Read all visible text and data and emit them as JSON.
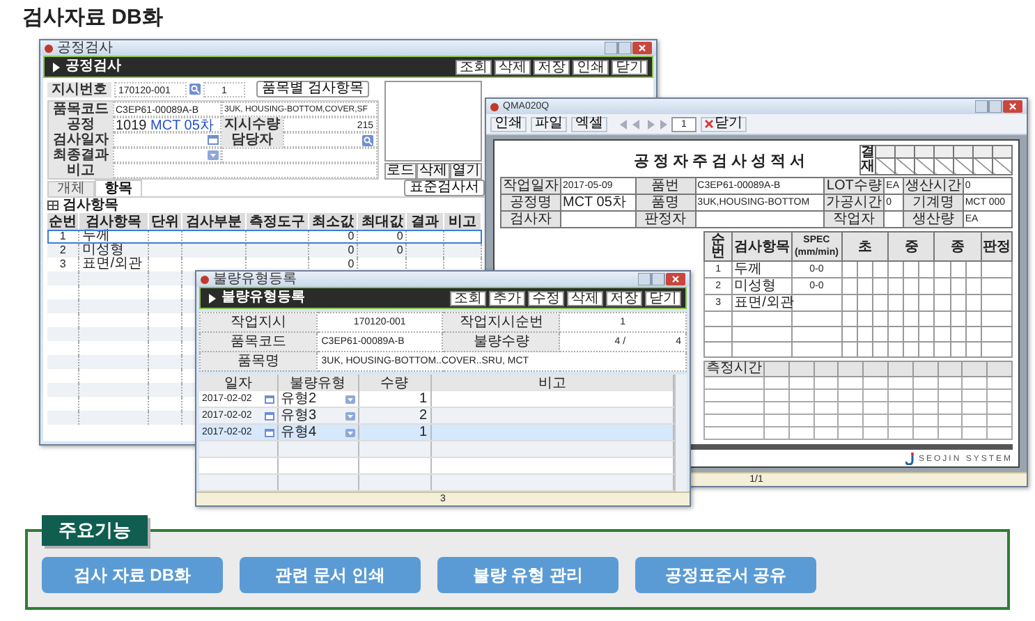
{
  "title": "검사자료 DB화",
  "inspection_window": {
    "title": "공정검사",
    "header": "공정검사",
    "toolbar": [
      "조회",
      "삭제",
      "저장",
      "인쇄",
      "닫기"
    ],
    "form": {
      "order_no_label": "지시번호",
      "order_no": "170120-001",
      "order_seq": "1",
      "item_button": "품목별 검사항목",
      "item_code_label": "품목코드",
      "item_code": "C3EP61-00089A-B",
      "item_name": "3UK, HOUSING-BOTTOM,COVER,SF",
      "process_label": "공정",
      "process_code": "1019",
      "process_name": "MCT 05차",
      "qty_label": "지시수량",
      "qty": "215",
      "date_label": "검사일자",
      "manager_label": "담당자",
      "result_label": "최종결과",
      "remark_label": "비고"
    },
    "attachment_buttons": [
      "로드",
      "삭제",
      "열기"
    ],
    "tabs": [
      {
        "label": "개체",
        "selected": false
      },
      {
        "label": "항목",
        "selected": true
      }
    ],
    "standard_button": "표준검사서",
    "section": "검사항목",
    "table": {
      "columns": [
        "순번",
        "검사항목",
        "단위",
        "검사부분",
        "측정도구",
        "최소값",
        "최대값",
        "결과",
        "비고"
      ],
      "rows": [
        {
          "no": "1",
          "item": "두께",
          "min": "0",
          "max": "0",
          "selected": true
        },
        {
          "no": "2",
          "item": "미성형",
          "min": "0",
          "max": "0",
          "selected": false
        },
        {
          "no": "3",
          "item": "표면/외관",
          "min": "0",
          "selected": false
        }
      ]
    }
  },
  "report_window": {
    "title": "QMA020Q",
    "toolbar": [
      "인쇄",
      "파일",
      "엑셀"
    ],
    "page": "1",
    "close": "닫기",
    "doc_title": "공정자주검사성적서",
    "approval_label": "결재",
    "info": [
      {
        "label": "작업일자",
        "value": "2017-05-09"
      },
      {
        "label": "품번",
        "value": "C3EP61-00089A-B"
      },
      {
        "label": "LOT수량",
        "value": "EA"
      },
      {
        "label": "생산시간",
        "value": "0"
      },
      {
        "label": "공정명",
        "value": "MCT 05차"
      },
      {
        "label": "품명",
        "value": "3UK,HOUSING-BOTTOM"
      },
      {
        "label": "가공시간",
        "value": "0"
      },
      {
        "label": "기계명",
        "value": "MCT 000"
      },
      {
        "label": "검사자"
      },
      {
        "label": "판정자"
      },
      {
        "label": "작업자"
      },
      {
        "label": "생산량",
        "value": "EA"
      }
    ],
    "grid": {
      "columns": [
        "순번",
        "검사항목",
        "SPEC (mm/min)",
        "초",
        "중",
        "종",
        "판정"
      ],
      "rows": [
        {
          "no": "1",
          "item": "두께",
          "spec": "0-0"
        },
        {
          "no": "2",
          "item": "미성형",
          "spec": "0-0"
        },
        {
          "no": "3",
          "item": "표면/외관"
        }
      ]
    },
    "time_label": "측정시간",
    "logo": "SEOJIN SYSTEM",
    "status": "1/1"
  },
  "defect_window": {
    "title": "불량유형등록",
    "header": "불량유형등록",
    "toolbar": [
      "조회",
      "추가",
      "수정",
      "삭제",
      "저장",
      "닫기"
    ],
    "form": {
      "order_label": "작업지시",
      "order": "170120-001",
      "seq_label": "작업지시순번",
      "seq": "1",
      "code_label": "품목코드",
      "code": "C3EP61-00089A-B",
      "qty_label": "불량수량",
      "qty": "4 /",
      "qty_total": "4",
      "name_label": "품목명",
      "name": "3UK, HOUSING-BOTTOM..COVER..SRU, MCT"
    },
    "columns": [
      "일자",
      "불량유형",
      "수량",
      "비고"
    ],
    "rows": [
      {
        "date": "2017-02-02",
        "type": "유형2",
        "qty": "1",
        "selected": false
      },
      {
        "date": "2017-02-02",
        "type": "유형3",
        "qty": "2",
        "selected": false
      },
      {
        "date": "2017-02-02",
        "type": "유형4",
        "qty": "1",
        "selected": true
      }
    ],
    "status": "3"
  },
  "features": {
    "label": "주요기능",
    "buttons": [
      "검사 자료 DB화",
      "관련 문서 인쇄",
      "불량 유형 관리",
      "공정표준서 공유"
    ]
  }
}
